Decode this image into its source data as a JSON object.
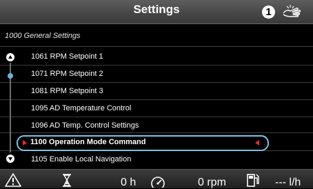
{
  "header": {
    "title": "Settings",
    "info_badge": "1",
    "icons": {
      "info": "info-icon",
      "touch": "hand-touch-icon"
    }
  },
  "breadcrumb": "1000 General Settings",
  "menu": {
    "items": [
      {
        "label": "1061 RPM Setpoint 1"
      },
      {
        "label": "1071 RPM Setpoint 2"
      },
      {
        "label": "1081 RPM Setpoint 3"
      },
      {
        "label": "1095 AD Temperature Control"
      },
      {
        "label": "1096 AD Temp. Control Settings"
      },
      {
        "label": "1100 Operation Mode Command"
      },
      {
        "label": "1105 Enable Local Navigation"
      }
    ],
    "selected_index": 5
  },
  "status": {
    "hours": "0 h",
    "rpm": "0 rpm",
    "fuel_rate": "--- l/h",
    "icons": [
      "warning-icon",
      "hourglass-icon",
      "speedometer-icon",
      "fuel-pump-icon"
    ]
  },
  "colors": {
    "highlight": "#7cc3ea",
    "selection_arrow": "#e23030",
    "scroll_thumb": "#6fb0dc",
    "background": "#000000"
  }
}
